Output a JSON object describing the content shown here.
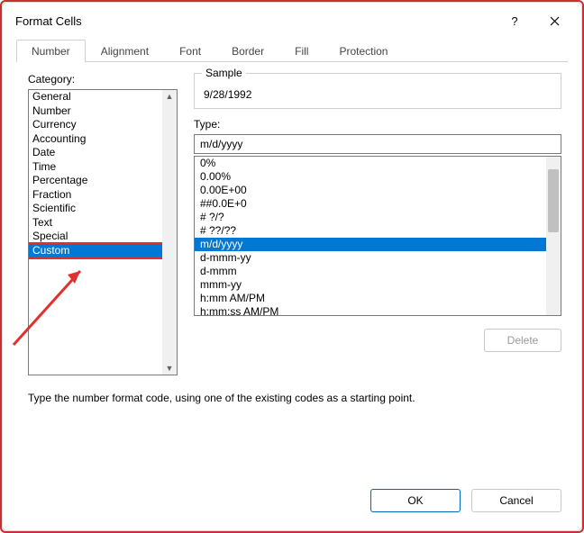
{
  "window": {
    "title": "Format Cells",
    "help": "?",
    "close": "✕"
  },
  "tabs": [
    "Number",
    "Alignment",
    "Font",
    "Border",
    "Fill",
    "Protection"
  ],
  "activeTab": 0,
  "categoryLabel": "Category:",
  "categories": [
    "General",
    "Number",
    "Currency",
    "Accounting",
    "Date",
    "Time",
    "Percentage",
    "Fraction",
    "Scientific",
    "Text",
    "Special",
    "Custom"
  ],
  "selectedCategory": 11,
  "sample": {
    "legend": "Sample",
    "value": "9/28/1992"
  },
  "typeLabel": "Type:",
  "typeValue": "m/d/yyyy",
  "typeList": [
    "0%",
    "0.00%",
    "0.00E+00",
    "##0.0E+0",
    "# ?/?",
    "# ??/??",
    "m/d/yyyy",
    "d-mmm-yy",
    "d-mmm",
    "mmm-yy",
    "h:mm AM/PM",
    "h:mm:ss AM/PM"
  ],
  "selectedType": 6,
  "deleteLabel": "Delete",
  "hint": "Type the number format code, using one of the existing codes as a starting point.",
  "ok": "OK",
  "cancel": "Cancel"
}
